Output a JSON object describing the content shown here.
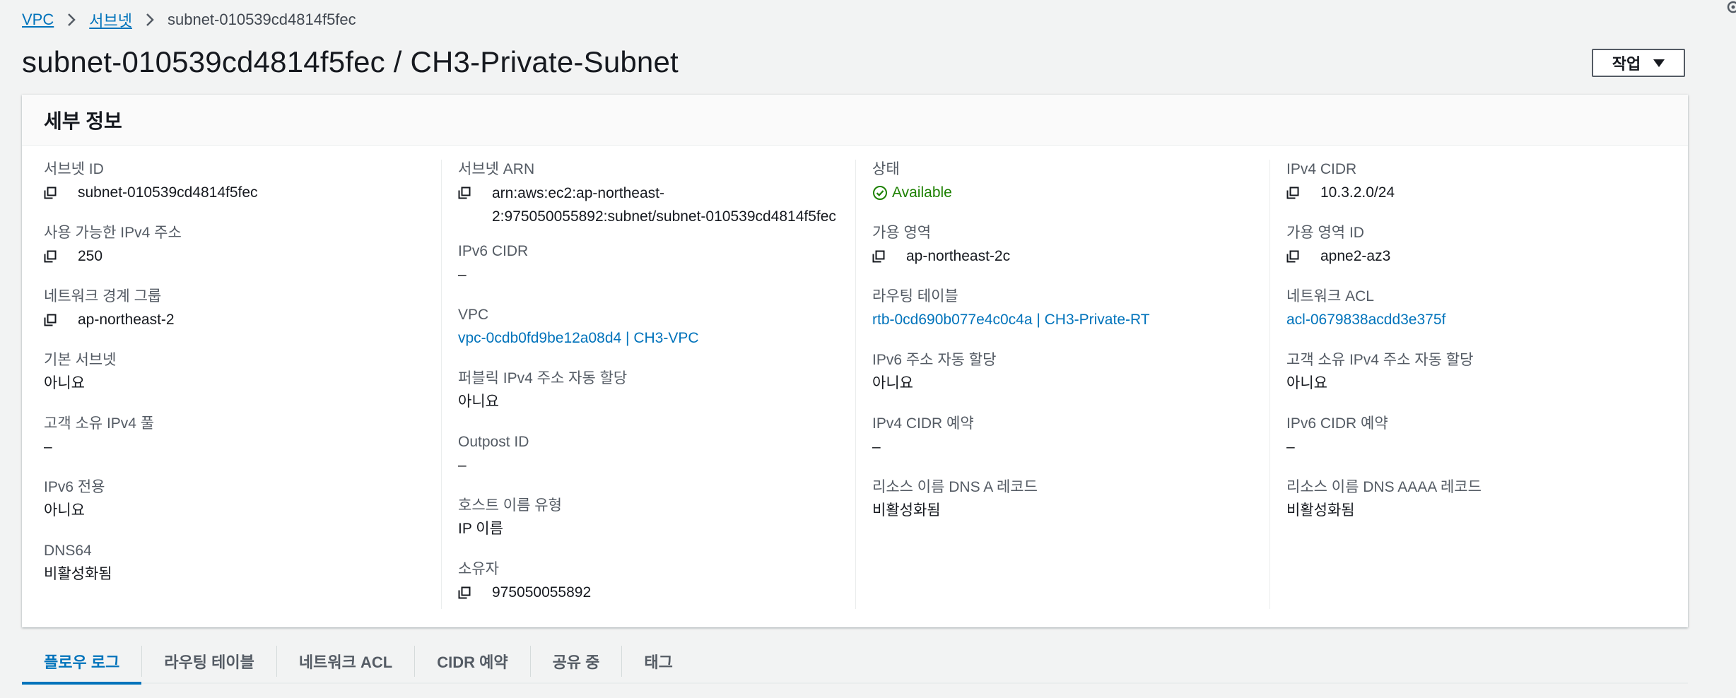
{
  "breadcrumb": {
    "items": [
      "VPC",
      "서브넷"
    ],
    "current": "subnet-010539cd4814f5fec"
  },
  "page": {
    "title": "subnet-010539cd4814f5fec / CH3-Private-Subnet",
    "action_button": "작업"
  },
  "details": {
    "header": "세부 정보",
    "columns": [
      [
        {
          "label": "서브넷 ID",
          "value": "subnet-010539cd4814f5fec",
          "copy": true
        },
        {
          "label": "사용 가능한 IPv4 주소",
          "value": "250",
          "copy": true
        },
        {
          "label": "네트워크 경계 그룹",
          "value": "ap-northeast-2",
          "copy": true
        },
        {
          "label": "기본 서브넷",
          "value": "아니요"
        },
        {
          "label": "고객 소유 IPv4 풀",
          "value": "–"
        },
        {
          "label": "IPv6 전용",
          "value": "아니요"
        },
        {
          "label": "DNS64",
          "value": "비활성화됨"
        }
      ],
      [
        {
          "label": "서브넷 ARN",
          "value_line1": "arn:aws:ec2:ap-northeast-",
          "value_line2": "2:975050055892:subnet/subnet-010539cd4814f5fec",
          "copy": true
        },
        {
          "label": "IPv6 CIDR",
          "value": "–"
        },
        {
          "label": "VPC",
          "value": "vpc-0cdb0fd9be12a08d4 | CH3-VPC",
          "link": true
        },
        {
          "label": "퍼블릭 IPv4 주소 자동 할당",
          "value": "아니요"
        },
        {
          "label": "Outpost ID",
          "value": "–"
        },
        {
          "label": "호스트 이름 유형",
          "value": "IP 이름"
        },
        {
          "label": "소유자",
          "value": "975050055892",
          "copy": true
        }
      ],
      [
        {
          "label": "상태",
          "value": "Available",
          "status": true
        },
        {
          "label": "가용 영역",
          "value": "ap-northeast-2c",
          "copy": true
        },
        {
          "label": "라우팅 테이블",
          "value": "rtb-0cd690b077e4c0c4a | CH3-Private-RT",
          "link": true
        },
        {
          "label": "IPv6 주소 자동 할당",
          "value": "아니요"
        },
        {
          "label": "IPv4 CIDR 예약",
          "value": "–"
        },
        {
          "label": "리소스 이름 DNS A 레코드",
          "value": "비활성화됨"
        }
      ],
      [
        {
          "label": "IPv4 CIDR",
          "value": "10.3.2.0/24",
          "copy": true
        },
        {
          "label": "가용 영역 ID",
          "value": "apne2-az3",
          "copy": true
        },
        {
          "label": "네트워크 ACL",
          "value": "acl-0679838acdd3e375f",
          "link": true
        },
        {
          "label": "고객 소유 IPv4 주소 자동 할당",
          "value": "아니요"
        },
        {
          "label": "IPv6 CIDR 예약",
          "value": "–"
        },
        {
          "label": "리소스 이름 DNS AAAA 레코드",
          "value": "비활성화됨"
        }
      ]
    ]
  },
  "tabs": [
    "플로우 로그",
    "라우팅 테이블",
    "네트워크 ACL",
    "CIDR 예약",
    "공유 중",
    "태그"
  ],
  "colors": {
    "link": "#0073bb",
    "status_ok": "#1d8102",
    "label": "#545b64",
    "text": "#16191f",
    "background": "#f2f3f3"
  },
  "icons": {
    "copy": "copy-icon",
    "status": "check-circle-icon",
    "breadcrumb_separator": "chevron-right-icon",
    "dropdown": "caret-down-icon"
  }
}
